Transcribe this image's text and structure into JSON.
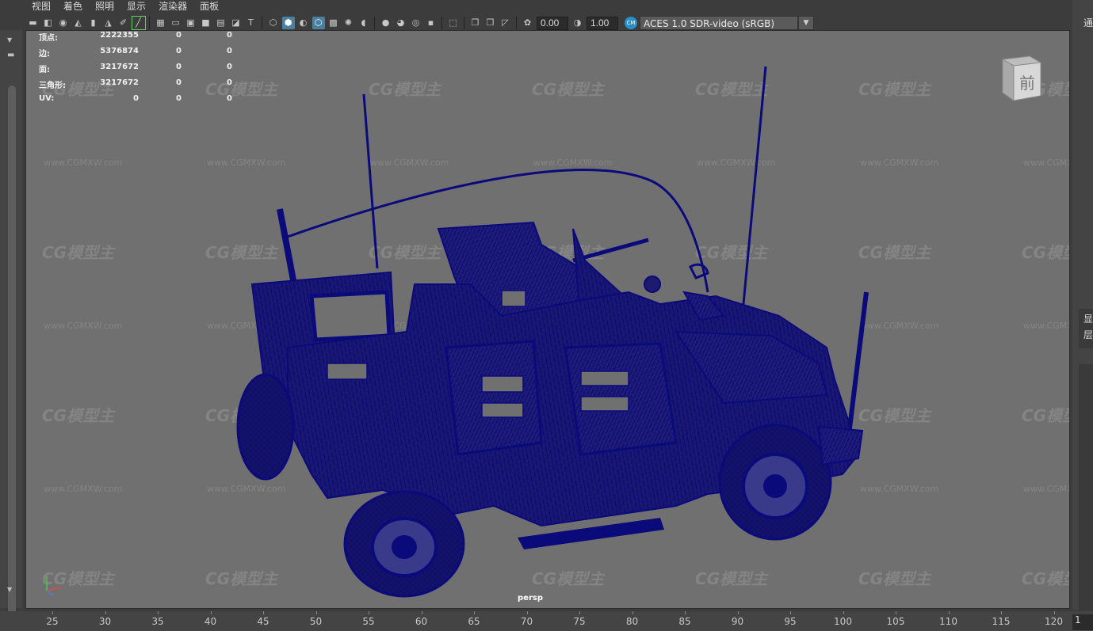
{
  "menubar": {
    "items": [
      "视图",
      "着色",
      "照明",
      "显示",
      "渲染器",
      "面板"
    ]
  },
  "toolbar": {
    "exposure_value": "0.00",
    "gamma_value": "1.00",
    "color_space_badge": "CM",
    "color_space": "ACES 1.0 SDR-video (sRGB)"
  },
  "hud": {
    "rows": [
      {
        "label": "顶点:",
        "v1": "2222355",
        "v2": "0",
        "v3": "0"
      },
      {
        "label": "边:",
        "v1": "5376874",
        "v2": "0",
        "v3": "0"
      },
      {
        "label": "面:",
        "v1": "3217672",
        "v2": "0",
        "v3": "0"
      },
      {
        "label": "三角形:",
        "v1": "3217672",
        "v2": "0",
        "v3": "0"
      },
      {
        "label": "UV:",
        "v1": "0",
        "v2": "0",
        "v3": "0"
      }
    ]
  },
  "viewport": {
    "camera_label": "persp",
    "view_cube_face": "前",
    "watermark_text": "CG模型主",
    "watermark_url": "www.CGMXW.com",
    "wire_color": "#0b0a7a"
  },
  "right_panel": {
    "top_label": "通",
    "side_label_1": "显",
    "side_label_2": "层"
  },
  "timeline": {
    "ticks": [
      "25",
      "30",
      "35",
      "40",
      "45",
      "50",
      "55",
      "60",
      "65",
      "70",
      "75",
      "80",
      "85",
      "90",
      "95",
      "100",
      "105",
      "110",
      "115",
      "120"
    ],
    "current_frame": "1"
  }
}
